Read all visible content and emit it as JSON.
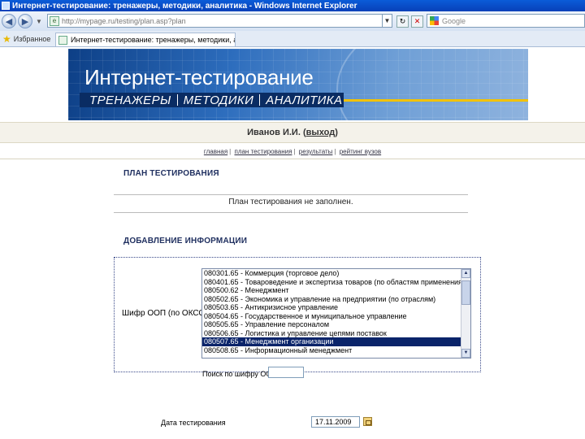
{
  "browser": {
    "title": "Интернет-тестирование: тренажеры, методики, аналитика - Windows Internet Explorer",
    "address": "http://mypage.ru/testing/plan.asp?plan",
    "search_placeholder": "Google",
    "favorites_label": "Избранное",
    "tab_label": "Интернет-тестирование: тренажеры, методики, а..."
  },
  "banner": {
    "title": "Интернет-тестирование",
    "nav": [
      "ТРЕНАЖЕРЫ",
      "МЕТОДИКИ",
      "АНАЛИТИКА"
    ]
  },
  "user": {
    "name": "Иванов И.И.",
    "logout": "выход"
  },
  "menu": [
    "главная",
    "план тестирования",
    "результаты",
    "рейтинг вузов"
  ],
  "plan": {
    "heading": "ПЛАН ТЕСТИРОВАНИЯ",
    "empty_message": "План тестирования не заполнен."
  },
  "add": {
    "heading": "ДОБАВЛЕНИЕ ИНФОРМАЦИИ",
    "code_label": "Шифр ООП (по ОКСО):",
    "options": [
      "080301.65 - Коммерция (торговое дело)",
      "080401.65 - Товароведение и экспертиза товаров (по областям применения)",
      "080500.62 - Менеджмент",
      "080502.65 - Экономика и управление на предприятии (по отраслям)",
      "080503.65 - Антикризисное управление",
      "080504.65 - Государственное и муниципальное управление",
      "080505.65 - Управление персоналом",
      "080506.65 - Логистика и управление цепями поставок",
      "080507.65 - Менеджмент организации",
      "080508.65 - Информационный менеджмент"
    ],
    "selected_option": "080507.65 - Менеджмент организации",
    "search_label": "Поиск по шифру ООП",
    "date_label": "Дата тестирования",
    "date_value": "17.11.2009"
  }
}
